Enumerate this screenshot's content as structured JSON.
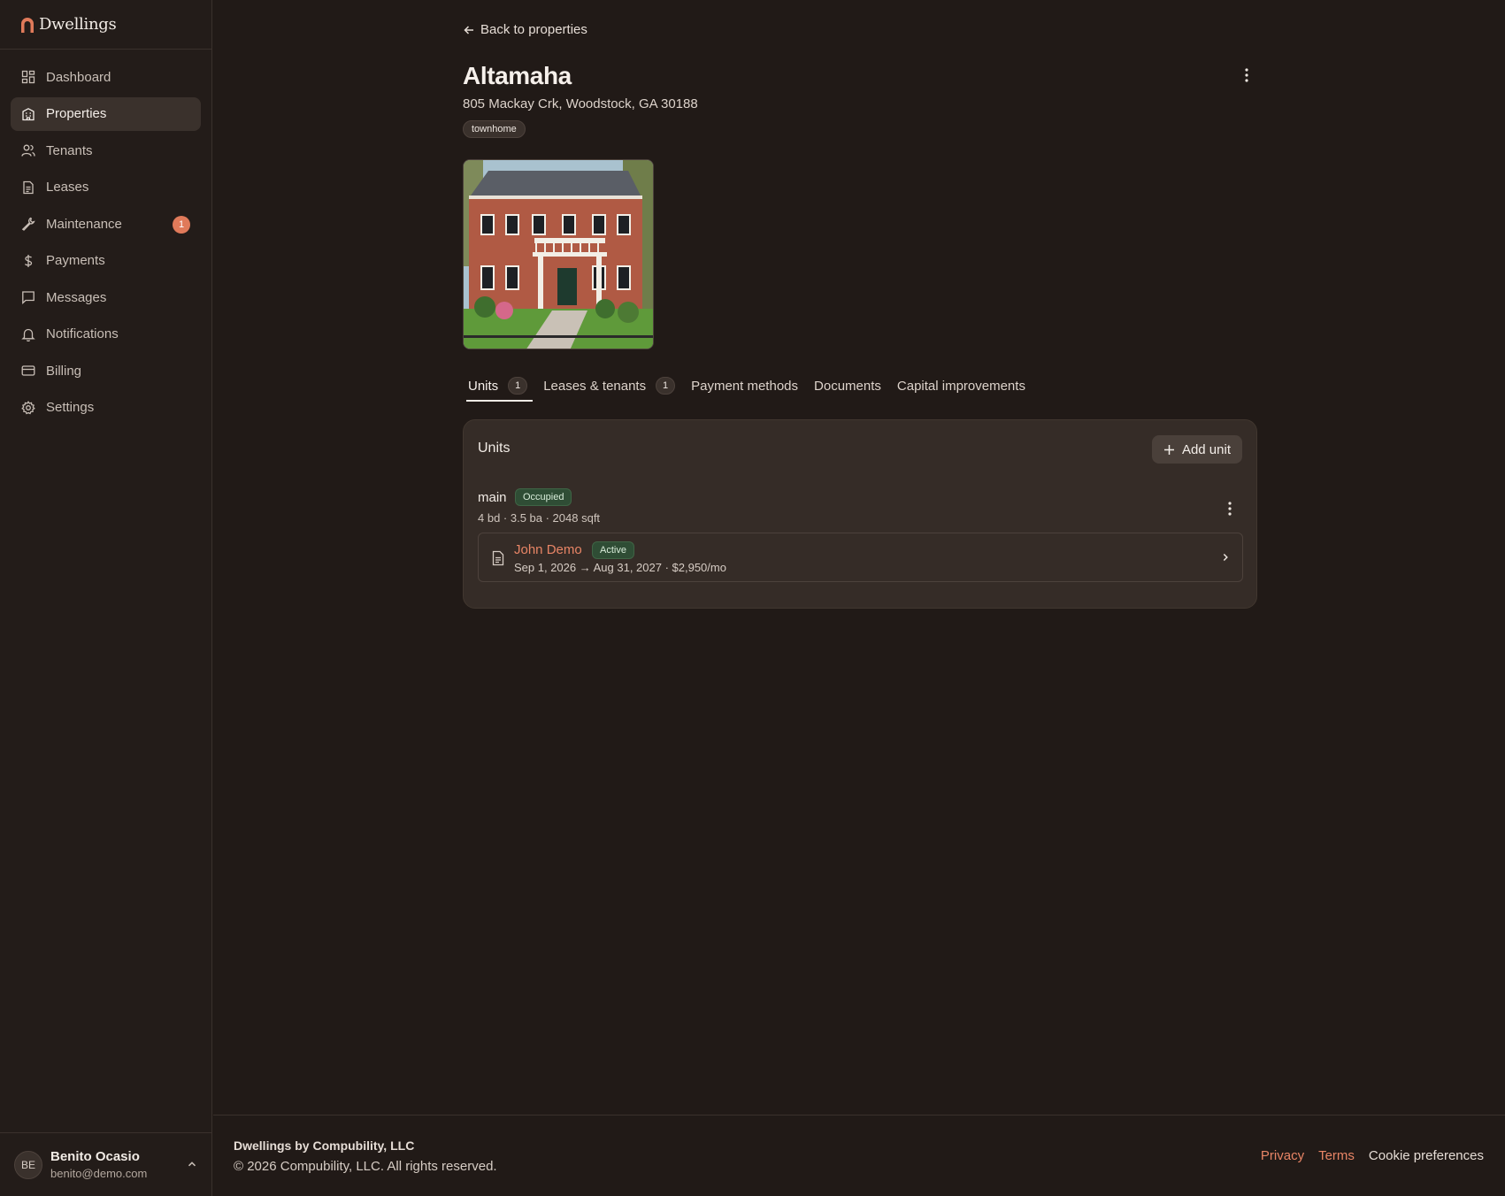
{
  "app": {
    "name": "Dwellings"
  },
  "sidebar": {
    "items": [
      {
        "label": "Dashboard",
        "icon": "dashboard-icon",
        "active": false
      },
      {
        "label": "Properties",
        "icon": "building-icon",
        "active": true
      },
      {
        "label": "Tenants",
        "icon": "users-icon",
        "active": false
      },
      {
        "label": "Leases",
        "icon": "document-icon",
        "active": false
      },
      {
        "label": "Maintenance",
        "icon": "wrench-icon",
        "active": false,
        "badge": "1"
      },
      {
        "label": "Payments",
        "icon": "dollar-icon",
        "active": false
      },
      {
        "label": "Messages",
        "icon": "message-icon",
        "active": false
      },
      {
        "label": "Notifications",
        "icon": "bell-icon",
        "active": false
      },
      {
        "label": "Billing",
        "icon": "credit-card-icon",
        "active": false
      },
      {
        "label": "Settings",
        "icon": "gear-icon",
        "active": false
      }
    ]
  },
  "user": {
    "initials": "BE",
    "name": "Benito Ocasio",
    "email": "benito@demo.com"
  },
  "property": {
    "back_label": "Back to properties",
    "title": "Altamaha",
    "address": "805 Mackay Crk, Woodstock, GA 30188",
    "type_tag": "townhome"
  },
  "tabs": [
    {
      "label": "Units",
      "count": "1",
      "active": true
    },
    {
      "label": "Leases & tenants",
      "count": "1",
      "active": false
    },
    {
      "label": "Payment methods",
      "active": false
    },
    {
      "label": "Documents",
      "active": false
    },
    {
      "label": "Capital improvements",
      "active": false
    }
  ],
  "units_card": {
    "title": "Units",
    "add_label": "Add unit",
    "unit": {
      "name": "main",
      "status": "Occupied",
      "stats": "4 bd · 3.5 ba · 2048 sqft",
      "lease": {
        "tenant": "John Demo",
        "status": "Active",
        "details": "Sep 1, 2026 → Aug 31, 2027 · $2,950/mo"
      }
    }
  },
  "footer": {
    "company": "Dwellings by Compubility, LLC",
    "copyright": "© 2026 Compubility, LLC. All rights reserved.",
    "links": [
      "Privacy",
      "Terms",
      "Cookie preferences"
    ]
  },
  "colors": {
    "accent": "#e07a5a",
    "background": "#211a17",
    "success": "#2f4d35"
  }
}
